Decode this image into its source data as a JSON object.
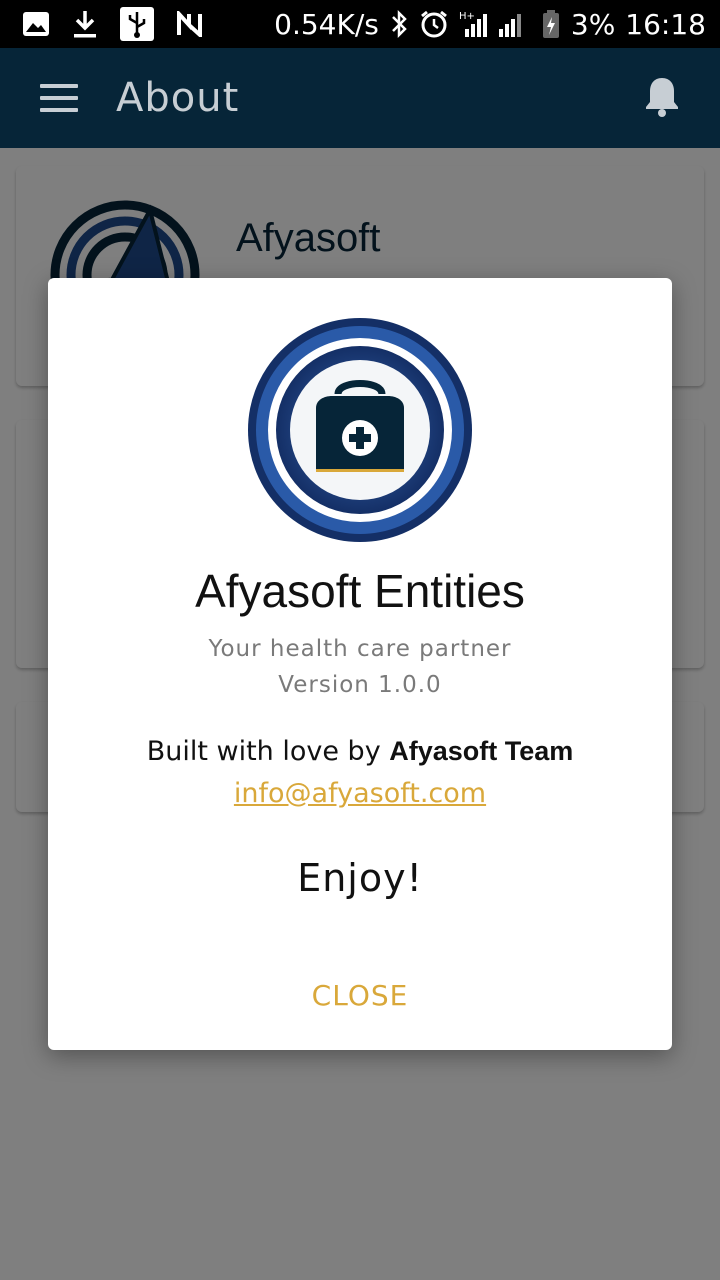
{
  "status_bar": {
    "network_speed": "0.54K/s",
    "battery_percent": "3%",
    "time": "16:18",
    "icons": [
      "image-icon",
      "download-icon",
      "usb-icon",
      "n-icon",
      "bluetooth-icon",
      "alarm-icon",
      "signal-icon",
      "battery-icon"
    ]
  },
  "app_bar": {
    "title": "About",
    "icons": [
      "menu-icon",
      "bell-icon"
    ]
  },
  "background_card": {
    "name": "Afyasoft"
  },
  "dialog": {
    "title": "Afyasoft Entities",
    "tagline": "Your health care partner",
    "version": "Version 1.0.0",
    "built_prefix": "Built with love by",
    "built_team": "Afyasoft Team",
    "email": "info@afyasoft.com",
    "enjoy": "Enjoy!",
    "close_label": "CLOSE"
  },
  "colors": {
    "app_bar": "#062538",
    "accent": "#d9a83a",
    "logo_blue": "#1f4a8c",
    "logo_dark": "#062538"
  }
}
